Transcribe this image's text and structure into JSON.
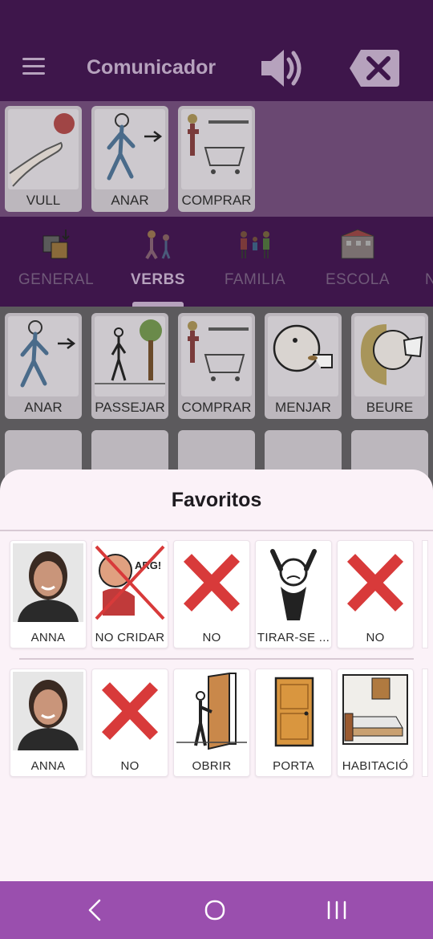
{
  "app": {
    "title": "Comunicador",
    "speak_icon": "speaker-icon",
    "delete_icon": "backspace-icon",
    "menu_icon": "hamburger-icon"
  },
  "sentence": {
    "cards": [
      {
        "label": "VULL",
        "icon": "hand-ball-icon"
      },
      {
        "label": "ANAR",
        "icon": "walking-person-icon"
      },
      {
        "label": "COMPRAR",
        "icon": "shopping-cart-icon"
      }
    ]
  },
  "categories": {
    "tabs": [
      {
        "label": "GENERAL",
        "icon": "general-icon",
        "active": false
      },
      {
        "label": "VERBS",
        "icon": "verbs-icon",
        "active": true
      },
      {
        "label": "FAMILIA",
        "icon": "family-icon",
        "active": false
      },
      {
        "label": "ESCOLA",
        "icon": "school-icon",
        "active": false
      },
      {
        "label": "N",
        "icon": "",
        "active": false
      }
    ]
  },
  "grid": {
    "row1": [
      {
        "label": "ANAR",
        "icon": "walking-person-icon"
      },
      {
        "label": "PASSEJAR",
        "icon": "stroll-icon"
      },
      {
        "label": "COMPRAR",
        "icon": "shopping-cart-icon"
      },
      {
        "label": "MENJAR",
        "icon": "eating-icon"
      },
      {
        "label": "BEURE",
        "icon": "drinking-icon"
      }
    ]
  },
  "favorites": {
    "title": "Favoritos",
    "row1": [
      {
        "label": "ANNA",
        "icon": "photo-avatar-icon"
      },
      {
        "label": "NO CRIDAR",
        "icon": "no-shouting-icon"
      },
      {
        "label": "NO",
        "icon": "red-cross-icon"
      },
      {
        "label": "TIRAR-SE ...",
        "icon": "angry-person-icon"
      },
      {
        "label": "NO",
        "icon": "red-cross-icon"
      }
    ],
    "row2": [
      {
        "label": "ANNA",
        "icon": "photo-avatar-icon"
      },
      {
        "label": "NO",
        "icon": "red-cross-icon"
      },
      {
        "label": "OBRIR",
        "icon": "open-door-icon"
      },
      {
        "label": "PORTA",
        "icon": "door-icon"
      },
      {
        "label": "HABITACIÓ",
        "icon": "bedroom-icon"
      }
    ]
  },
  "colors": {
    "topbar": "#3e164b",
    "sheet": "#fbf2f8",
    "navbar": "#9a4fae",
    "cross_red": "#d83a3a"
  },
  "navbar": {
    "back_icon": "nav-back-icon",
    "home_icon": "nav-home-icon",
    "recents_icon": "nav-recents-icon"
  }
}
